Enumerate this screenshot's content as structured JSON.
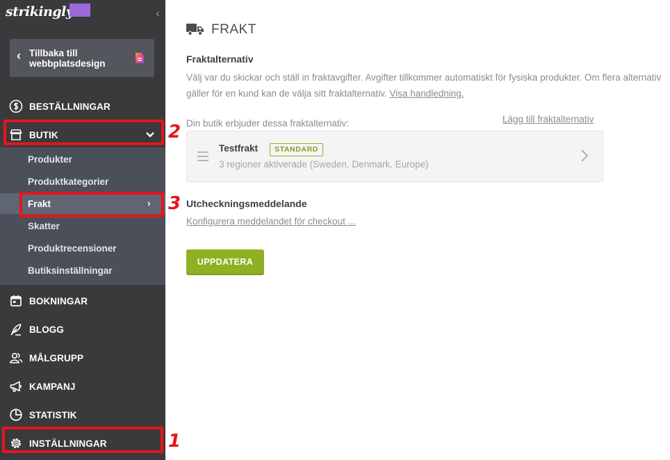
{
  "app": {
    "logo_text": "strikingly"
  },
  "sidebar": {
    "back_button": {
      "label": "Tillbaka till webbplatsdesign"
    },
    "collapse_glyph": "‹",
    "nav": {
      "orders": "BESTÄLLNINGAR",
      "store": "BUTIK",
      "bookings": "BOKNINGAR",
      "blog": "BLOGG",
      "audience": "MÅLGRUPP",
      "campaign": "KAMPANJ",
      "stats": "STATISTIK",
      "settings": "INSTÄLLNINGAR"
    },
    "store_sub": {
      "products": "Produkter",
      "categories": "Produktkategorier",
      "shipping": "Frakt",
      "taxes": "Skatter",
      "reviews": "Produktrecensioner",
      "store_settings": "Butiksinställningar"
    }
  },
  "annotations": {
    "step1": "1",
    "step2": "2",
    "step3": "3"
  },
  "main": {
    "page_title": "FRAKT",
    "shipping_options": {
      "title": "Fraktalternativ",
      "description": "Välj var du skickar och ställ in fraktavgifter. Avgifter tillkommer automatiskt för fysiska produkter. Om flera alternativ gäller för en kund kan de välja sitt fraktalternativ.",
      "guide_link": "Visa handledning.",
      "offer_label": "Din butik erbjuder dessa fraktalternativ:",
      "add_link": "Lägg till fraktalternativ"
    },
    "shipping_card": {
      "name": "Testfrakt",
      "badge": "STANDARD",
      "regions": "3 regioner aktiverade (Sweden, Denmark, Europe)"
    },
    "checkout": {
      "title": "Utcheckningsmeddelande",
      "link": "Konfigurera meddelandet för checkout ..."
    },
    "update_button": "UPPDATERA"
  },
  "colors": {
    "sidebar_bg": "#3a3a3d",
    "submenu_bg": "#4b4f5a",
    "accent_green": "#8fb022",
    "highlight_red": "#e8141c",
    "logo_badge": "#9b6ad8"
  }
}
